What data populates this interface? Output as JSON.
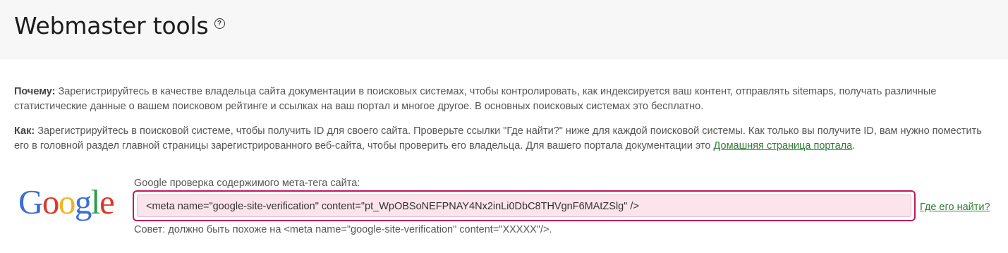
{
  "header": {
    "title": "Webmaster tools",
    "help_icon": "question-circle-icon"
  },
  "intro": {
    "why_label": "Почему:",
    "why_text": " Зарегистрируйтесь в качестве владельца сайта документации в поисковых системах, чтобы контролировать, как индексируется ваш контент, отправлять sitemaps, получать различные статистические данные о вашем поисковом рейтинге и ссылках на ваш портал и многое другое. В основных поисковых системах это бесплатно.",
    "how_label": "Как:",
    "how_text": " Зарегистрируйтесь в поисковой системе, чтобы получить ID для своего сайта. Проверьте ссылки \"Где найти?\" ниже для каждой поисковой системы. Как только вы получите ID, вам нужно поместить его в головной раздел главной страницы зарегистрированного веб-сайта, чтобы проверить его владельца. Для вашего портала документации это ",
    "how_link": "Домашняя страница портала",
    "how_end": "."
  },
  "google": {
    "logo_letters": [
      "G",
      "o",
      "o",
      "g",
      "l",
      "e"
    ],
    "logo_colors": [
      "#3b6fd6",
      "#d93a2b",
      "#f2b519",
      "#3b6fd6",
      "#2e9e48",
      "#d93a2b"
    ],
    "label": "Google проверка содержимого мета-тега сайта:",
    "value": "<meta name=\"google-site-verification\" content=\"pt_WpOBSoNEFPNAY4Nx2inLi0DbC8THVgnF6MAtZSlg\" />",
    "where_link": "Где его найти?",
    "hint": "Совет: должно быть похоже на <meta name=\"google-site-verification\" content=\"XXXXX\"/>."
  },
  "colors": {
    "accent_border": "#c2185b",
    "input_bg": "#fce4ec",
    "link": "#2e7d32"
  }
}
